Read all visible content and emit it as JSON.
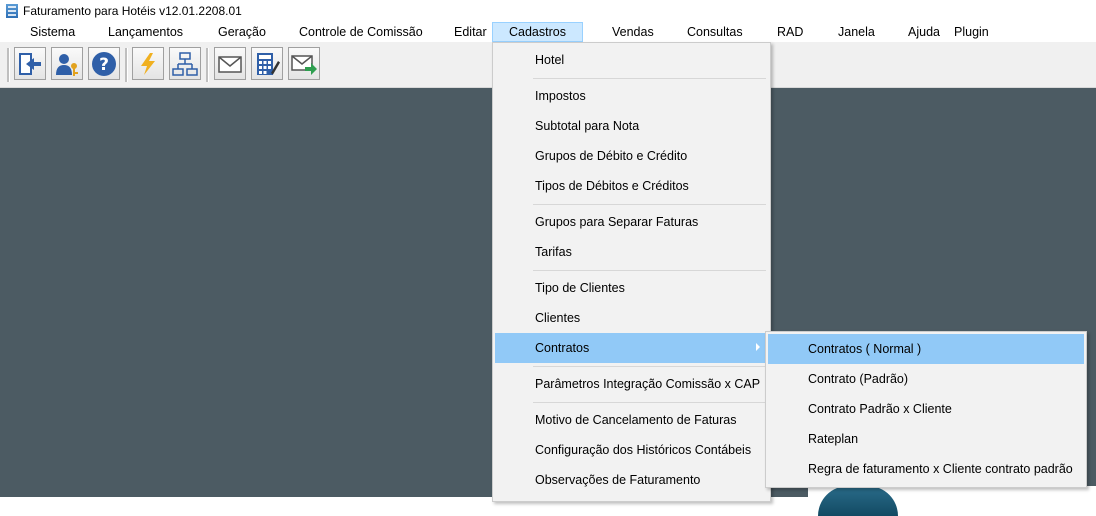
{
  "window": {
    "title": "Faturamento para Hotéis v12.01.2208.01"
  },
  "menubar": {
    "items": [
      {
        "label": "Sistema"
      },
      {
        "label": "Lançamentos"
      },
      {
        "label": "Geração"
      },
      {
        "label": "Controle de Comissão"
      },
      {
        "label": "Editar"
      },
      {
        "label": "Cadastros"
      },
      {
        "label": "Vendas"
      },
      {
        "label": "Consultas"
      },
      {
        "label": "RAD"
      },
      {
        "label": "Janela"
      },
      {
        "label": "Ajuda"
      },
      {
        "label": "Plugin"
      }
    ],
    "active": "Cadastros"
  },
  "toolbar": {
    "buttons": [
      {
        "icon": "exit-icon"
      },
      {
        "icon": "user-key-icon"
      },
      {
        "icon": "help-icon"
      },
      {
        "icon": "lightning-icon"
      },
      {
        "icon": "org-chart-icon"
      },
      {
        "icon": "mail-icon"
      },
      {
        "icon": "calculator-edit-icon"
      },
      {
        "icon": "mail-send-icon"
      }
    ]
  },
  "cadastros_menu": {
    "items": [
      {
        "label": "Hotel"
      },
      {
        "label": "Impostos"
      },
      {
        "label": "Subtotal para Nota"
      },
      {
        "label": "Grupos de Débito e Crédito"
      },
      {
        "label": "Tipos de Débitos e Créditos"
      },
      {
        "label": "Grupos para Separar Faturas"
      },
      {
        "label": "Tarifas"
      },
      {
        "label": "Tipo de Clientes"
      },
      {
        "label": "Clientes"
      },
      {
        "label": "Contratos",
        "has_submenu": true,
        "highlighted": true
      },
      {
        "label": "Parâmetros Integração Comissão x CAP"
      },
      {
        "label": "Motivo de Cancelamento de Faturas"
      },
      {
        "label": "Configuração dos Históricos Contábeis"
      },
      {
        "label": "Observações de Faturamento"
      }
    ]
  },
  "contratos_submenu": {
    "items": [
      {
        "label": "Contratos ( Normal )",
        "highlighted": true
      },
      {
        "label": "Contrato (Padrão)"
      },
      {
        "label": "Contrato Padrão x Cliente"
      },
      {
        "label": "Rateplan"
      },
      {
        "label": "Regra de faturamento x Cliente contrato padrão"
      }
    ]
  },
  "colors": {
    "workspace": "#4c5b63",
    "menu_highlight": "#91c9f7",
    "menubar_active": "#cce8ff"
  }
}
